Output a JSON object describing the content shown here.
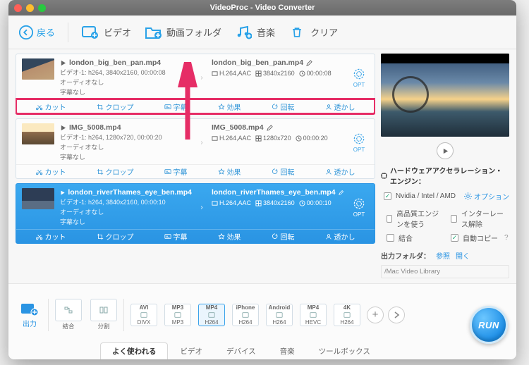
{
  "window": {
    "title": "VideoProc - Video Converter"
  },
  "toolbar": {
    "back": "戻る",
    "video": "ビデオ",
    "folder": "動画フォルダ",
    "music": "音楽",
    "clear": "クリア"
  },
  "items": [
    {
      "filename": "london_big_ben_pan.mp4",
      "info": "ビデオ-1: h264, 3840x2160, 00:00:08",
      "audio": "オーディオなし",
      "sub": "字幕なし",
      "out_filename": "london_big_ben_pan.mp4",
      "codec": "H.264,AAC",
      "res": "3840x2160",
      "dur": "00:00:08",
      "opt": "OPT"
    },
    {
      "filename": "IMG_5008.mp4",
      "info": "ビデオ-1: h264, 1280x720, 00:00:20",
      "audio": "オーディオなし",
      "sub": "字幕なし",
      "out_filename": "IMG_5008.mp4",
      "codec": "H.264,AAC",
      "res": "1280x720",
      "dur": "00:00:20",
      "opt": "OPT"
    },
    {
      "filename": "london_riverThames_eye_ben.mp4",
      "info": "ビデオ-1: h264, 3840x2160, 00:00:10",
      "audio": "オーディオなし",
      "sub": "字幕なし",
      "out_filename": "london_riverThames_eye_ben.mp4",
      "codec": "H.264,AAC",
      "res": "3840x2160",
      "dur": "00:00:10",
      "opt": "OPT"
    }
  ],
  "actions": {
    "cut": "カット",
    "crop": "クロップ",
    "subtitle": "字幕",
    "effect": "効果",
    "rotate": "回転",
    "watermark": "透かし"
  },
  "side": {
    "hw_title": "ハードウェアアクセラレーション・エンジン：",
    "gpu": "Nvidia / Intel / AMD",
    "option": "オプション",
    "hq": "高品質エンジンを使う",
    "deint": "インターレース解除",
    "merge": "結合",
    "autocopy": "自動コピー",
    "help": "?",
    "outfolder_label": "出力フォルダ：",
    "browse": "参照",
    "open": "開く",
    "path": "/Mac Video Library"
  },
  "bottom": {
    "output": "出力",
    "merge": "結合",
    "split": "分割",
    "presets": [
      {
        "top": "AVI",
        "bot": "DIVX"
      },
      {
        "top": "MP3",
        "bot": "MP3"
      },
      {
        "top": "MP4",
        "bot": "H264",
        "sel": true
      },
      {
        "top": "iPhone",
        "bot": "H264"
      },
      {
        "top": "Android",
        "bot": "H264"
      },
      {
        "top": "MP4",
        "bot": "HEVC"
      },
      {
        "top": "4K",
        "bot": "H264"
      }
    ],
    "tabs": {
      "popular": "よく使われる",
      "video": "ビデオ",
      "device": "デバイス",
      "music": "音楽",
      "toolbox": "ツールボックス"
    },
    "run": "RUN"
  }
}
